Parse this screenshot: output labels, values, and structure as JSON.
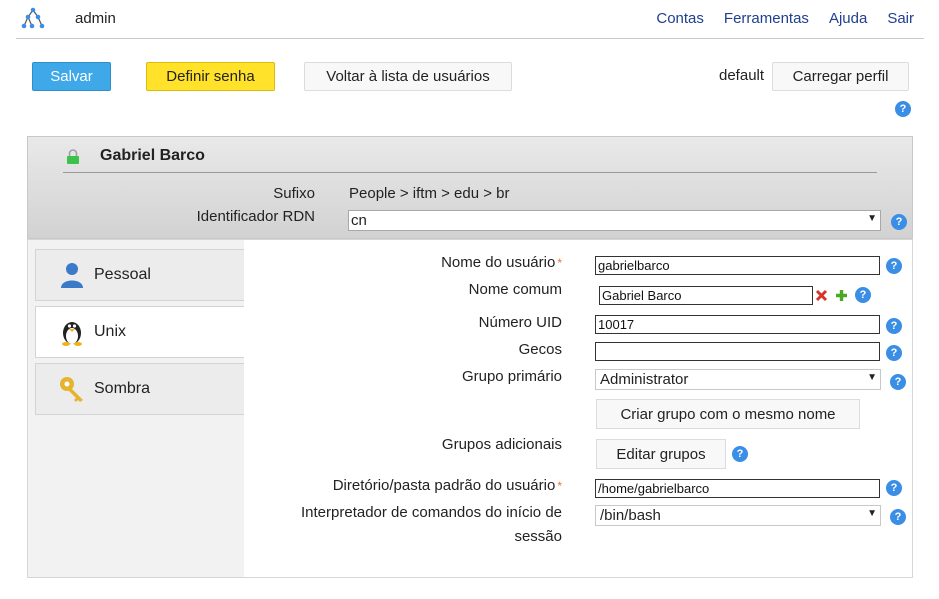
{
  "topbar": {
    "user": "admin",
    "nav": [
      "Contas",
      "Ferramentas",
      "Ajuda",
      "Sair"
    ]
  },
  "toolbar": {
    "save_label": "Salvar",
    "set_password_label": "Definir senha",
    "back_label": "Voltar à lista de usuários",
    "profile_name": "default",
    "load_profile_label": "Carregar perfil"
  },
  "header": {
    "title": "Gabriel Barco",
    "suffix_label": "Sufixo",
    "suffix_value": "People > iftm > edu > br",
    "rdn_label": "Identificador RDN",
    "rdn_value": "cn"
  },
  "tabs": [
    {
      "label": "Pessoal",
      "icon": "person-icon"
    },
    {
      "label": "Unix",
      "icon": "tux-penguin-icon"
    },
    {
      "label": "Sombra",
      "icon": "key-icon"
    }
  ],
  "form": {
    "username_label": "Nome do usuário",
    "username_value": "gabrielbarco",
    "common_name_label": "Nome comum",
    "common_name_value": "Gabriel Barco",
    "uid_label": "Número UID",
    "uid_value": "10017",
    "gecos_label": "Gecos",
    "gecos_value": "",
    "primary_group_label": "Grupo primário",
    "primary_group_value": "Administrator",
    "create_group_label": "Criar grupo com o mesmo nome",
    "additional_groups_label": "Grupos adicionais",
    "edit_groups_label": "Editar grupos",
    "home_dir_label": "Diretório/pasta padrão do usuário",
    "home_dir_value": "/home/gabrielbarco",
    "shell_label_line1": "Interpretador de comandos do início de",
    "shell_label_line2": "sessão",
    "shell_value": "/bin/bash",
    "required_mark": "*"
  },
  "help_glyph": "?",
  "colors": {
    "save": "#3ea8e8",
    "password": "#ffe229",
    "help": "#3a8ee6",
    "link": "#1f3f8f",
    "required": "#e8742a"
  }
}
